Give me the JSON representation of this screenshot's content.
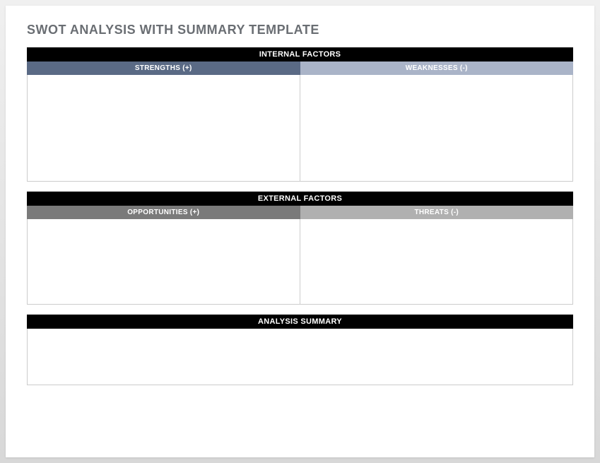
{
  "title": "SWOT ANALYSIS WITH SUMMARY TEMPLATE",
  "internal": {
    "header": "INTERNAL FACTORS",
    "strengths_label": "STRENGTHS (+)",
    "weaknesses_label": "WEAKNESSES (-)",
    "strengths_content": "",
    "weaknesses_content": ""
  },
  "external": {
    "header": "EXTERNAL FACTORS",
    "opportunities_label": "OPPORTUNITIES (+)",
    "threats_label": "THREATS (-)",
    "opportunities_content": "",
    "threats_content": ""
  },
  "summary": {
    "header": "ANALYSIS SUMMARY",
    "content": ""
  }
}
